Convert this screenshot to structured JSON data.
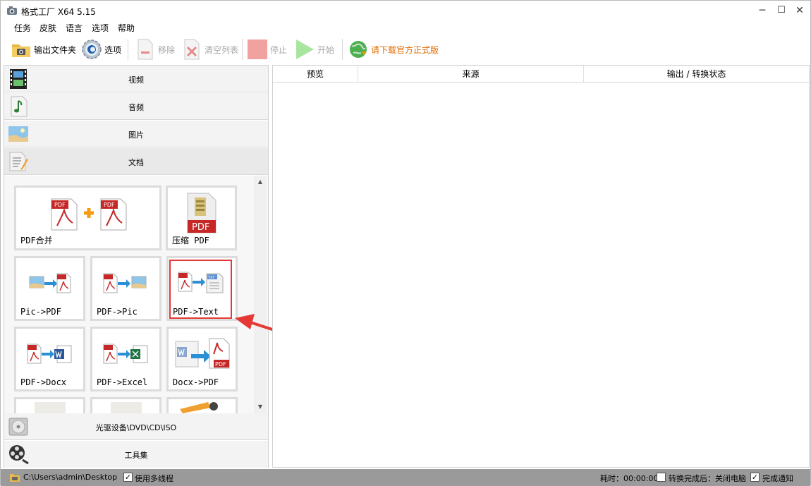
{
  "window": {
    "title": "格式工厂 X64 5.15",
    "minimize": "─",
    "maximize": "☐",
    "close": "✕"
  },
  "menu": {
    "task": "任务",
    "skin": "皮肤",
    "language": "语言",
    "options": "选项",
    "help": "帮助"
  },
  "toolbar": {
    "output_folder": "输出文件夹",
    "options": "选项",
    "remove": "移除",
    "clear_list": "清空列表",
    "stop": "停止",
    "start": "开始",
    "download": "请下载官方正式版"
  },
  "categories": {
    "video": "视频",
    "audio": "音频",
    "image": "图片",
    "document": "文档",
    "disc": "光驱设备\\DVD\\CD\\ISO",
    "tools": "工具集"
  },
  "doc_tools": {
    "pdf_merge": "PDF合并",
    "compress_pdf": "压缩 PDF",
    "pic_to_pdf": "Pic->PDF",
    "pdf_to_pic": "PDF->Pic",
    "pdf_to_text": "PDF->Text",
    "pdf_to_docx": "PDF->Docx",
    "pdf_to_excel": "PDF->Excel",
    "docx_to_pdf": "Docx->PDF"
  },
  "icon_text": {
    "pdf": "PDF",
    "txt": "TXT"
  },
  "table": {
    "preview": "预览",
    "source": "来源",
    "output_status": "输出 / 转换状态"
  },
  "status": {
    "path": "C:\\Users\\admin\\Desktop",
    "multithread": "使用多线程",
    "elapsed": "耗时：00:00:00",
    "after_convert": "转换完成后：关闭电脑",
    "notify": "完成通知"
  },
  "colors": {
    "accent_red": "#e53935",
    "download_orange": "#e06c00",
    "pdf_red": "#c62828"
  }
}
